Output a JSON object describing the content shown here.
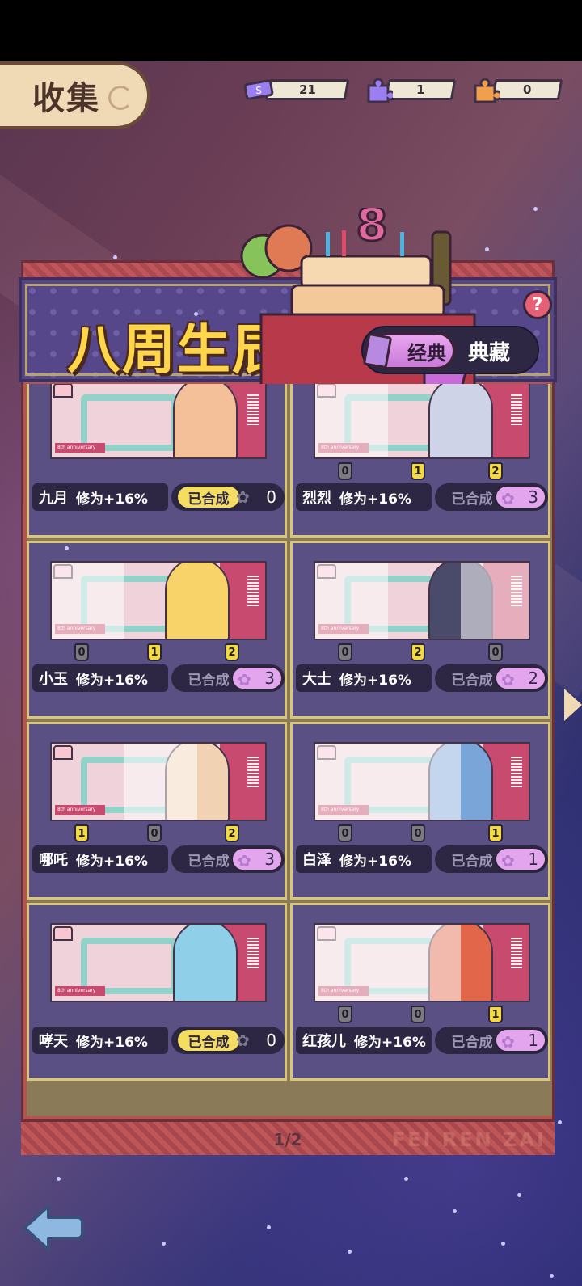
{
  "header": {
    "collect_label": "收集"
  },
  "resources": [
    {
      "icon": "ticket-icon",
      "value": "21",
      "color": "#9b7ef0"
    },
    {
      "icon": "purple-puzzle-icon",
      "value": "1",
      "color": "#9b7ef0"
    },
    {
      "icon": "orange-puzzle-icon",
      "value": "0",
      "color": "#f0a04a"
    }
  ],
  "event": {
    "title": "八周生辰",
    "help_label": "?"
  },
  "tabs": {
    "classic": "经典",
    "collection": "典藏"
  },
  "cards": [
    {
      "name": "九月",
      "bonus": "修为+16%",
      "status": "已合成",
      "count": "0",
      "done": true,
      "frags": [],
      "fig_color": "#f4c09a"
    },
    {
      "name": "烈烈",
      "bonus": "修为+16%",
      "status": "已合成",
      "count": "3",
      "done": false,
      "frags": [
        "0",
        "1",
        "2"
      ],
      "fig_color": "#cfd3e8"
    },
    {
      "name": "小玉",
      "bonus": "修为+16%",
      "status": "已合成",
      "count": "3",
      "done": false,
      "frags": [
        "0",
        "1",
        "2"
      ],
      "fig_color": "#f7d36a"
    },
    {
      "name": "大士",
      "bonus": "修为+16%",
      "status": "已合成",
      "count": "2",
      "done": false,
      "frags": [
        "0",
        "2",
        "0"
      ],
      "fig_color": "#4a4a6a"
    },
    {
      "name": "哪吒",
      "bonus": "修为+16%",
      "status": "已合成",
      "count": "3",
      "done": false,
      "frags": [
        "1",
        "0",
        "2"
      ],
      "fig_color": "#f1d3b4"
    },
    {
      "name": "白泽",
      "bonus": "修为+16%",
      "status": "已合成",
      "count": "1",
      "done": false,
      "frags": [
        "0",
        "0",
        "1"
      ],
      "fig_color": "#7aa5d9"
    },
    {
      "name": "哮天",
      "bonus": "修为+16%",
      "status": "已合成",
      "count": "0",
      "done": true,
      "frags": [],
      "fig_color": "#8fd0e8"
    },
    {
      "name": "红孩儿",
      "bonus": "修为+16%",
      "status": "已合成",
      "count": "1",
      "done": false,
      "frags": [
        "0",
        "0",
        "1"
      ],
      "fig_color": "#e2674a"
    }
  ],
  "pager": "1/2",
  "watermark": "FEI REN ZAI",
  "art_caption": "8th anniversary"
}
